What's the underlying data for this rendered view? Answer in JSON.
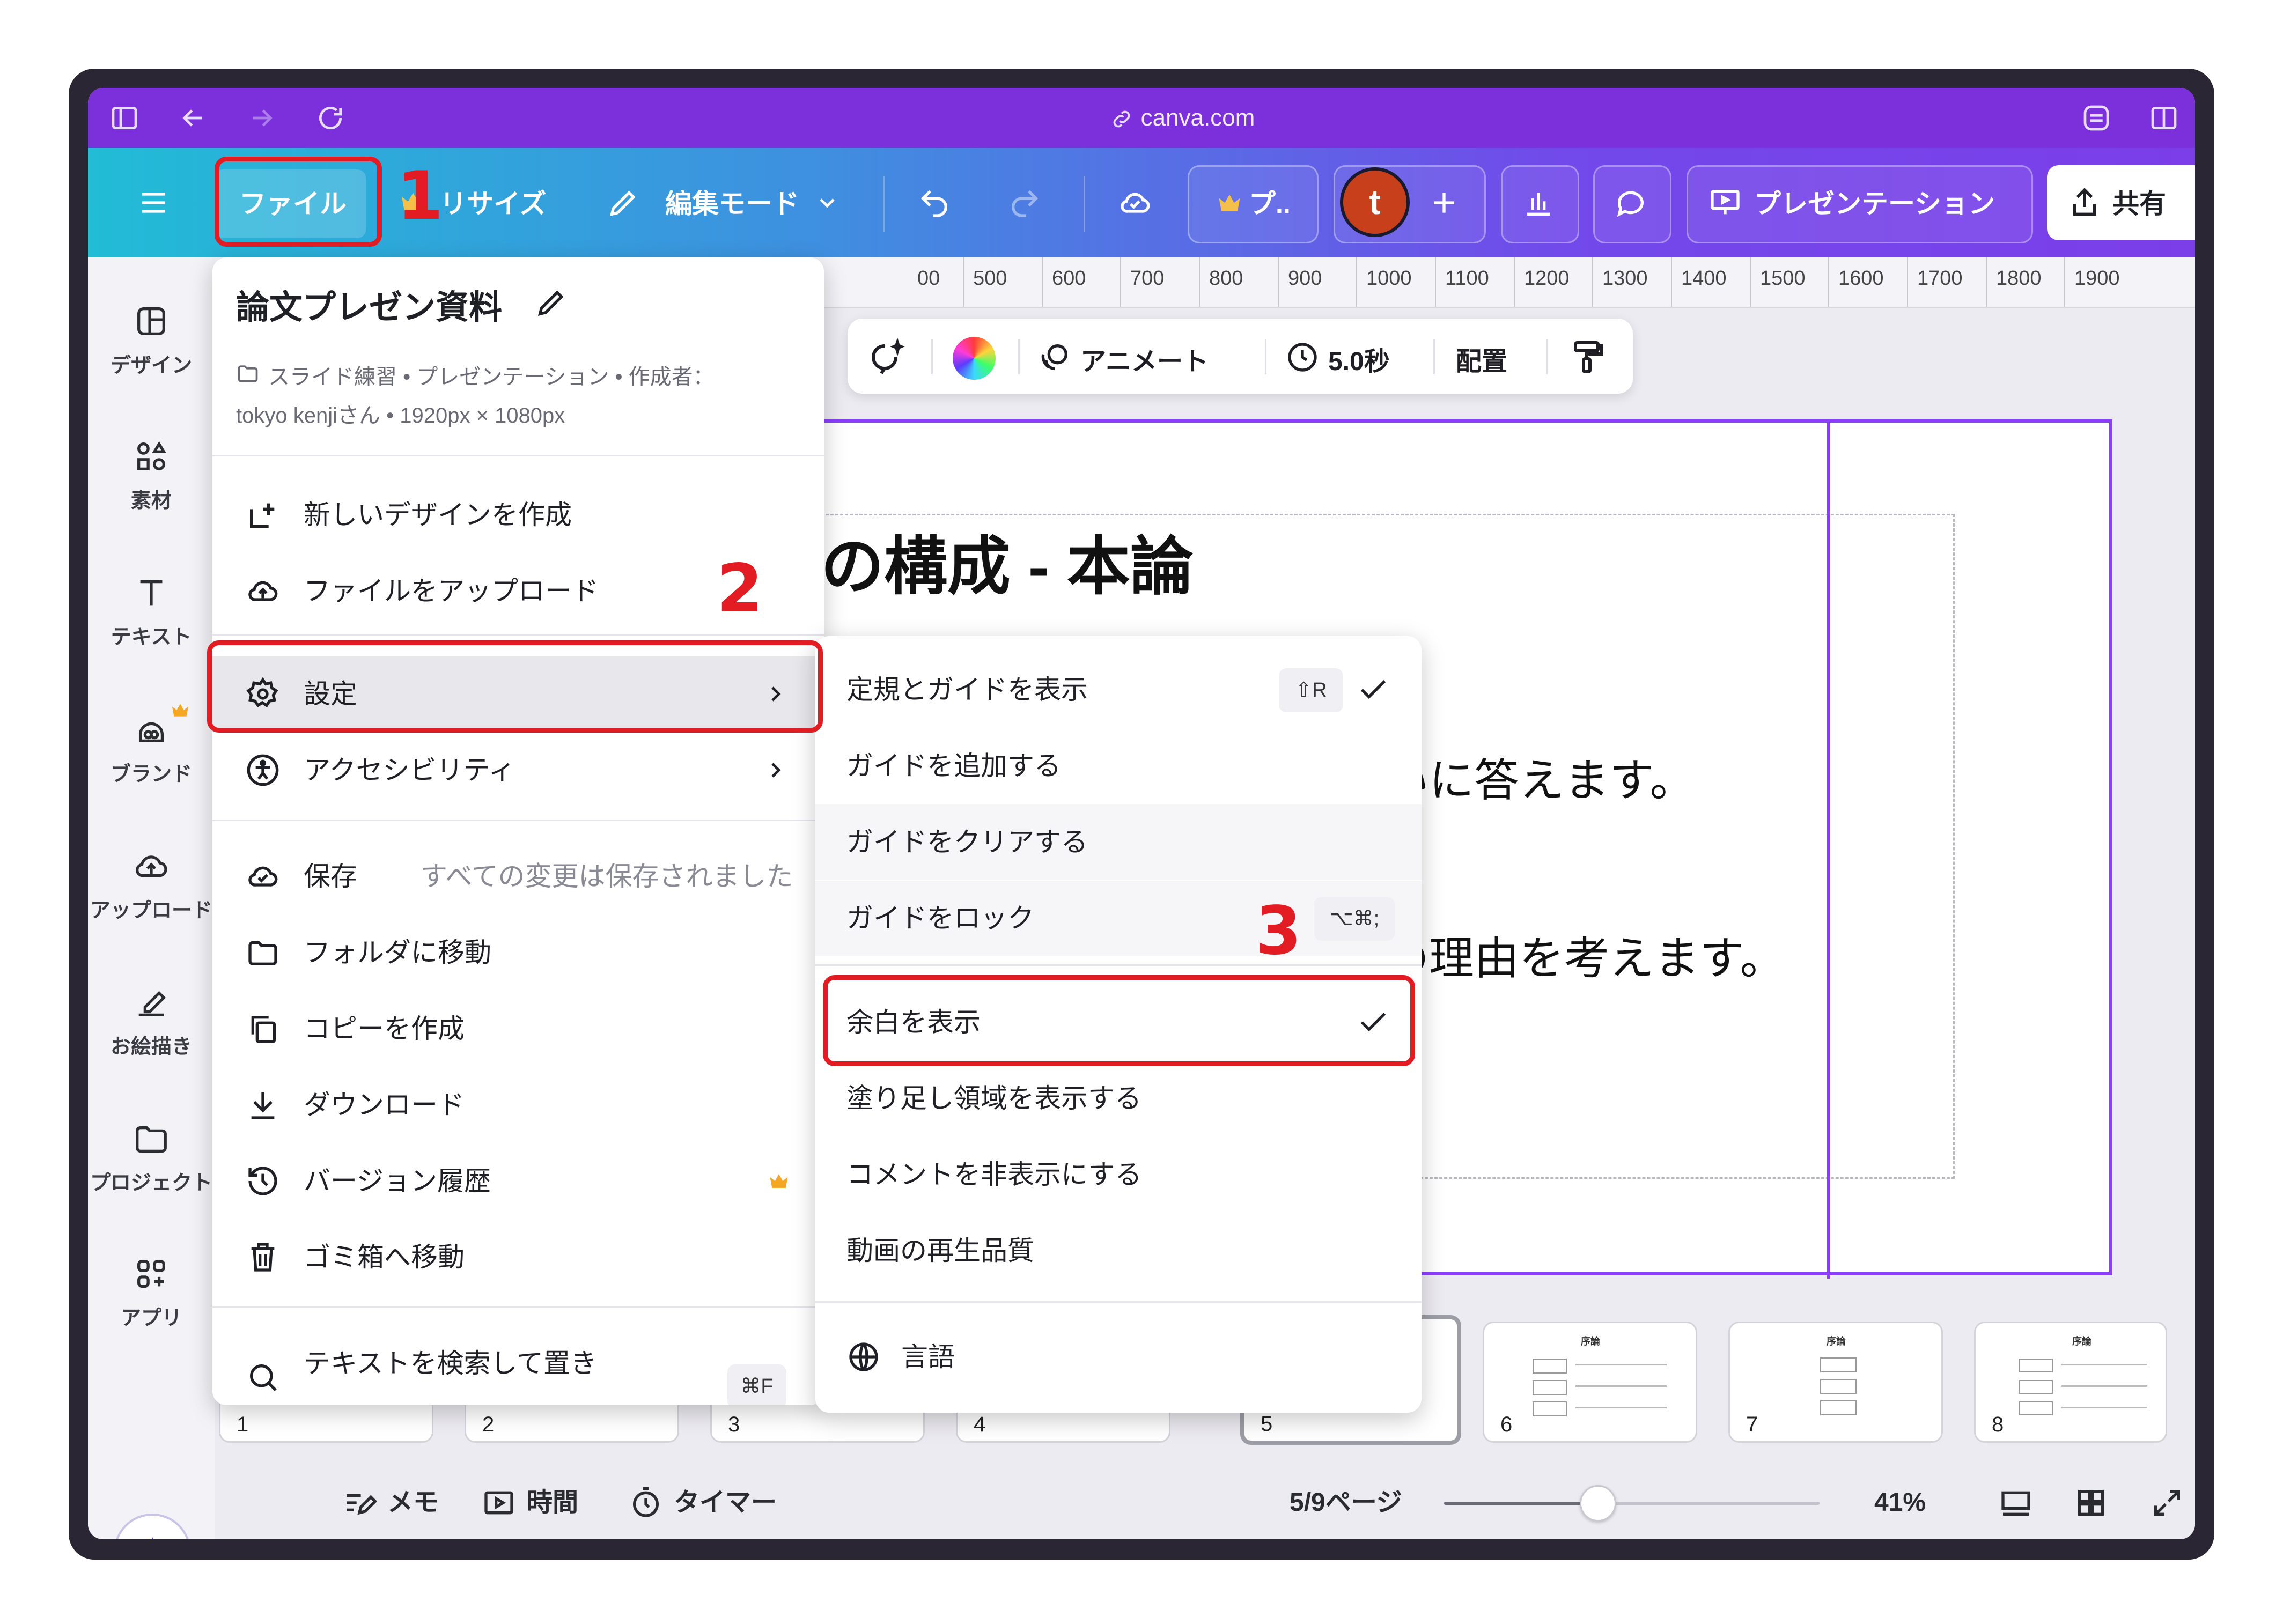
{
  "browser": {
    "url": "canva.com"
  },
  "toolbar": {
    "file": "ファイル",
    "resize": "リサイズ",
    "edit_mode": "編集モード",
    "pro_label": "プ..",
    "avatar_initial": "t",
    "present": "プレゼンテーション",
    "share": "共有"
  },
  "sidebar": {
    "items": [
      {
        "label": "デザイン",
        "icon": "design-icon"
      },
      {
        "label": "素材",
        "icon": "elements-icon"
      },
      {
        "label": "テキスト",
        "icon": "text-icon"
      },
      {
        "label": "ブランド",
        "icon": "brand-icon"
      },
      {
        "label": "アップロード",
        "icon": "upload-icon"
      },
      {
        "label": "お絵描き",
        "icon": "draw-icon"
      },
      {
        "label": "プロジェクト",
        "icon": "folder-icon"
      },
      {
        "label": "アプリ",
        "icon": "apps-icon"
      }
    ]
  },
  "ruler": {
    "ticks": [
      "00",
      "500",
      "600",
      "700",
      "800",
      "900",
      "1000",
      "1100",
      "1200",
      "1300",
      "1400",
      "1500",
      "1600",
      "1700",
      "1800",
      "1900"
    ]
  },
  "context_toolbar": {
    "animate": "アニメート",
    "duration": "5.0秒",
    "position": "配置"
  },
  "canvas": {
    "title": "の構成 - 本論",
    "line1": "いに答えます。",
    "line2": "の理由を考えます。"
  },
  "file_menu": {
    "doc_title": "論文プレゼン資料",
    "meta_line1": "スライド練習 • プレゼンテーション • 作成者：",
    "meta_line2": "tokyo kenjiさん • 1920px × 1080px",
    "items": {
      "new_design": "新しいデザインを作成",
      "upload": "ファイルをアップロード",
      "settings": "設定",
      "accessibility": "アクセシビリティ",
      "save": "保存",
      "save_status": "すべての変更は保存されました",
      "move_folder": "フォルダに移動",
      "copy": "コピーを作成",
      "download": "ダウンロード",
      "version_history": "バージョン履歴",
      "trash": "ゴミ箱へ移動",
      "find_replace": "テキストを検索して置き",
      "find_shortcut": "⌘F"
    }
  },
  "settings_menu": {
    "show_rulers": "定規とガイドを表示",
    "show_rulers_shortcut": "⇧R",
    "add_guide": "ガイドを追加する",
    "clear_guides": "ガイドをクリアする",
    "lock_guides": "ガイドをロック",
    "lock_shortcut": "⌥⌘;",
    "show_margins": "余白を表示",
    "show_bleed": "塗り足し領域を表示する",
    "hide_comments": "コメントを非表示にする",
    "video_quality": "動画の再生品質",
    "language": "言語"
  },
  "annotations": {
    "step1": "1",
    "step2": "2",
    "step3": "3"
  },
  "thumbnails": [
    "1",
    "2",
    "3",
    "4",
    "5",
    "6",
    "7",
    "8"
  ],
  "thumbnail_title": "序論",
  "bottom": {
    "notes": "メモ",
    "time": "時間",
    "timer": "タイマー",
    "page": "5/9ページ",
    "zoom": "41%",
    "zoom_fraction": 0.41
  },
  "colors": {
    "accent": "#8b3dff",
    "annotation_red": "#e21c22",
    "avatar": "#c8401b",
    "crown": "#f5a623"
  }
}
